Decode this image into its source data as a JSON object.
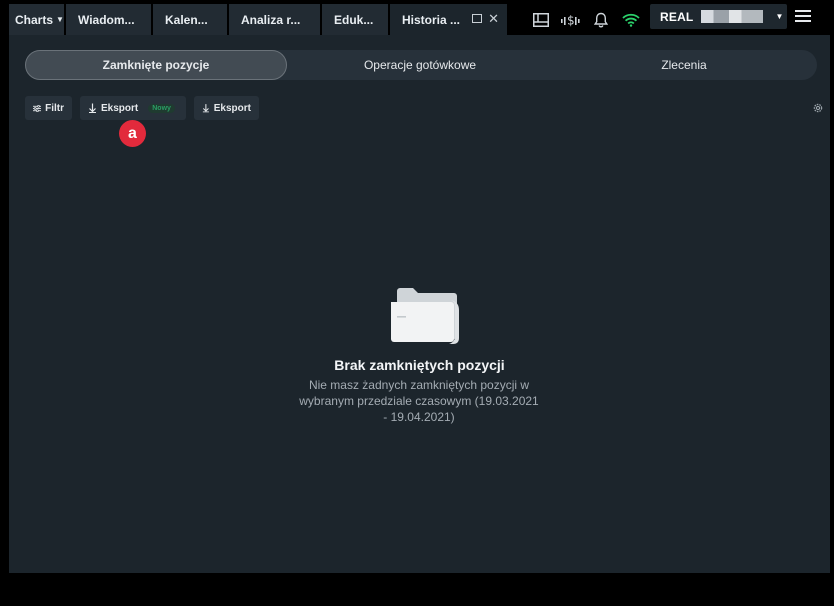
{
  "tabs": [
    {
      "label": "Charts",
      "active": false
    },
    {
      "label": "Wiadom...",
      "active": false
    },
    {
      "label": "Kalen...",
      "active": false
    },
    {
      "label": "Analiza r...",
      "active": false
    },
    {
      "label": "Eduk...",
      "active": false
    },
    {
      "label": "Historia ...",
      "active": true
    }
  ],
  "tray_icons": [
    "layout-icon",
    "dollar-signal-icon",
    "bell-icon",
    "wifi-icon"
  ],
  "account": {
    "type_label": "REAL"
  },
  "segments": [
    {
      "label": "Zamknięte pozycje",
      "selected": true
    },
    {
      "label": "Operacje gotówkowe",
      "selected": false
    },
    {
      "label": "Zlecenia",
      "selected": false
    }
  ],
  "toolbar": {
    "filter_label": "Filtr",
    "export_label": "Eksport",
    "new_badge": "Nowy",
    "export2_label": "Eksport"
  },
  "marker": {
    "label": "a"
  },
  "empty_state": {
    "title": "Brak zamkniętych pozycji",
    "description": "Nie masz żadnych zamkniętych pozycji w wybranym przedziale czasowym (19.03.2021 - 19.04.2021)"
  },
  "colors": {
    "background": "#1c252c",
    "tab": "#222b33",
    "accent_green": "#2bd16b",
    "marker_red": "#e22a3c"
  }
}
